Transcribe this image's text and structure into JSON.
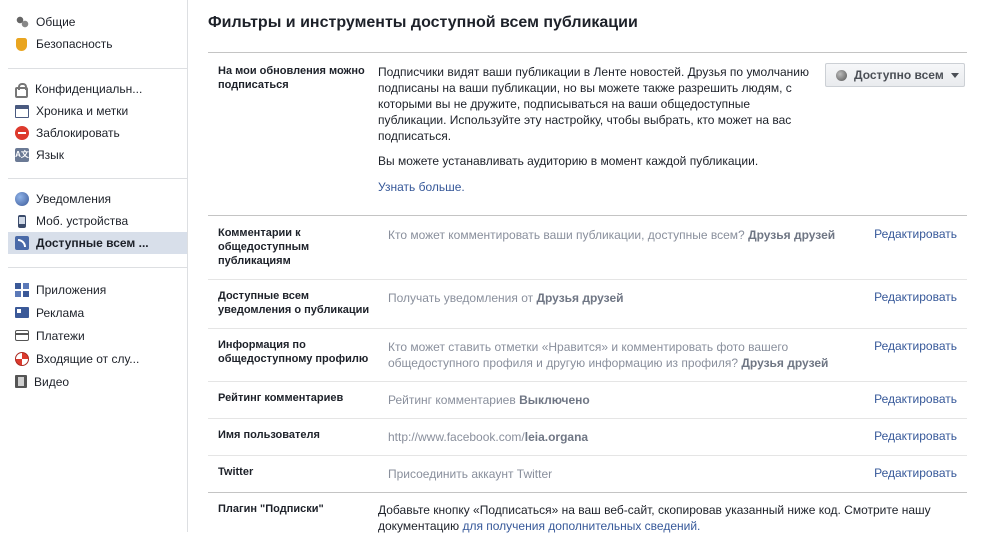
{
  "sidebar": {
    "groups": [
      [
        {
          "label": "Общие",
          "icon": "gear-icon"
        },
        {
          "label": "Безопасность",
          "icon": "shield-icon"
        }
      ],
      [
        {
          "label": "Конфиденциальн...",
          "icon": "lock-icon"
        },
        {
          "label": "Хроника и метки",
          "icon": "timeline-icon"
        },
        {
          "label": "Заблокировать",
          "icon": "block-icon"
        },
        {
          "label": "Язык",
          "icon": "language-icon",
          "icon_text": "A文"
        }
      ],
      [
        {
          "label": "Уведомления",
          "icon": "globe-icon"
        },
        {
          "label": "Моб. устройства",
          "icon": "phone-icon"
        },
        {
          "label": "Доступные всем ...",
          "icon": "rss-icon",
          "active": true
        }
      ],
      [
        {
          "label": "Приложения",
          "icon": "apps-icon"
        },
        {
          "label": "Реклама",
          "icon": "ads-icon"
        },
        {
          "label": "Платежи",
          "icon": "card-icon"
        },
        {
          "label": "Входящие от слу...",
          "icon": "lifebuoy-icon"
        },
        {
          "label": "Видео",
          "icon": "film-icon"
        }
      ]
    ]
  },
  "main": {
    "title": "Фильтры и инструменты доступной всем публикации",
    "follow": {
      "label": "На мои обновления можно подписаться",
      "desc1": "Подписчики видят ваши публикации в Ленте новостей. Друзья по умолчанию подписаны на ваши публикации, но вы можете также разрешить людям, с которыми вы не дружите, подписываться на ваши общедоступные публикации. Используйте эту настройку, чтобы выбрать, кто может на вас подписаться.",
      "desc2": "Вы можете устанавливать аудиторию в момент каждой публикации.",
      "learn_more": "Узнать больше.",
      "audience": "Доступно всем"
    },
    "rows": [
      {
        "label": "Комментарии к общедоступным публикациям",
        "text": "Кто может комментировать ваши публикации, доступные всем?",
        "value": "Друзья друзей",
        "edit": "Редактировать"
      },
      {
        "label": "Доступные всем уведомления о публикации",
        "text": "Получать уведомления от",
        "value": "Друзья друзей",
        "edit": "Редактировать"
      },
      {
        "label": "Информация по общедоступному профилю",
        "text": "Кто может ставить отметки «Нравится» и комментировать фото вашего общедоступного профиля и другую информацию из профиля?",
        "value": "Друзья друзей",
        "edit": "Редактировать"
      },
      {
        "label": "Рейтинг комментариев",
        "text": "Рейтинг комментариев",
        "value": "Выключено",
        "edit": "Редактировать"
      },
      {
        "label": "Имя пользователя",
        "text": "http://www.facebook.com/",
        "value": "leia.organa",
        "edit": "Редактировать"
      },
      {
        "label": "Twitter",
        "text": "Присоединить аккаунт Twitter",
        "value": "",
        "edit": "Редактировать"
      }
    ],
    "plugin": {
      "label": "Плагин \"Подписки\"",
      "text": "Добавьте кнопку «Подписаться» на ваш веб-сайт, скопировав указанный ниже код. Смотрите нашу документацию",
      "link": "для получения дополнительных сведений."
    }
  }
}
